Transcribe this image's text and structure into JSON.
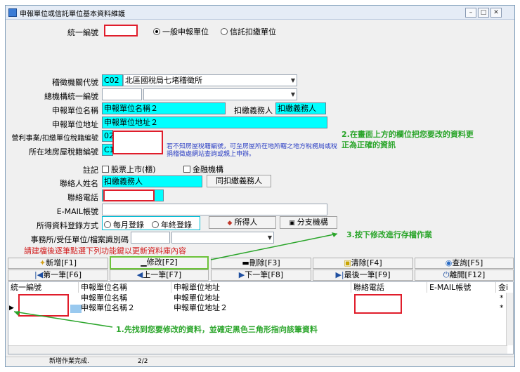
{
  "window": {
    "title": "申報單位或信託單位基本資料維護"
  },
  "form": {
    "unified_no_label": "統一編號",
    "unit_type_options": [
      "一般申報單位",
      "信託扣繳單位"
    ],
    "tax_office_label": "稽徵機關代號",
    "tax_office_code": "C02",
    "tax_office_name": "北區國稅局七堵稽徵所",
    "hq_unified_no_label": "總機構統一編號",
    "unit_name_label": "申報單位名稱",
    "unit_name_value": "申報單位名稱２",
    "withholder_label": "扣繳義務人",
    "withholder_value": "扣繳義務人",
    "unit_address_label": "申報單位地址",
    "unit_address_value": "申報單位地址２",
    "business_tax_label": "營利事業/扣繳單位稅籍編號",
    "business_tax_value": "02",
    "house_tax_label": "所在地房屋稅籍編號",
    "house_tax_value": "C1",
    "house_tax_note": "若不知房屋稅籍編號，可至房屋所在地所轄之地方稅務局或稅捐稽徵處網站查詢或親上申辦。",
    "note_label": "註記",
    "listed_label": "股票上市(櫃)",
    "financial_label": "金融機構",
    "contact_name_label": "聯絡人姓名",
    "contact_name_value": "扣繳義務人",
    "same_as_withholder_label": "同扣繳義務人",
    "phone_label": "聯絡電話",
    "email_label": "E-MAIL帳號",
    "income_reg_label": "所得資料登錄方式",
    "income_reg_options": [
      "每月登錄",
      "年終登錄"
    ],
    "earner_label": "所得人",
    "branch_label": "分支機構",
    "office_label": "事務所/受任單位/檔案識別碼",
    "warning": "請建檔後逐筆點選下列功能鍵以更新資料庫內容"
  },
  "toolbar": {
    "add": "新增[F1]",
    "edit": "修改[F2]",
    "delete": "刪除[F3]",
    "clear": "清除[F4]",
    "query": "查詢[F5]",
    "first": "第一筆[F6]",
    "prev": "上一筆[F7]",
    "next": "下一筆[F8]",
    "last": "最後一筆[F9]",
    "exit": "離開[F12]"
  },
  "grid": {
    "headers": [
      "統一編號",
      "申報單位名稱",
      "申報單位地址",
      "聯絡電話",
      "E-MAIL帳號",
      "金i"
    ],
    "rows": [
      {
        "name": "申報單位名稱",
        "address": "申報單位地址",
        "mark": "*"
      },
      {
        "name": "申報單位名稱２",
        "address": "申報單位地址２",
        "mark": "*"
      }
    ]
  },
  "status": {
    "message": "新增作業完成.",
    "page": "2/2"
  },
  "annotations": {
    "step1": "1.先找到您要修改的資料，並確定黑色三角形指向該筆資料",
    "step2_line1": "2.在畫面上方的欄位把您要改的資料更",
    "step2_line2": "正為正確的資訊",
    "step3": "3.按下修改進行存檔作業"
  },
  "colors": {
    "highlight": "#00ffff",
    "annotation": "#2aa52a",
    "warning": "#d11b1b",
    "redbox": "#e01d2b"
  }
}
